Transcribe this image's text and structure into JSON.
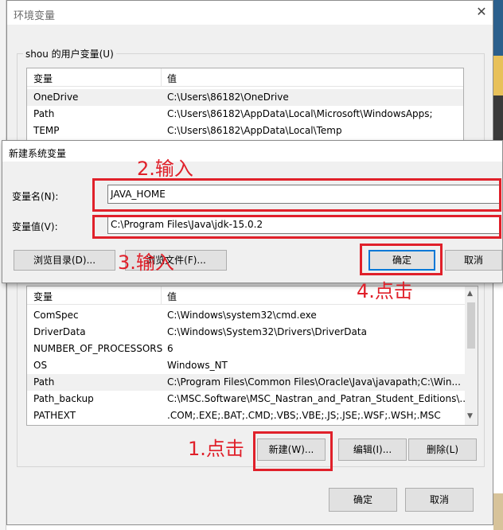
{
  "window": {
    "title": "环境变量",
    "close": "✕"
  },
  "user_vars": {
    "label": "shou 的用户变量(U)",
    "col_name": "变量",
    "col_value": "值",
    "rows": [
      {
        "name": "OneDrive",
        "value": "C:\\Users\\86182\\OneDrive"
      },
      {
        "name": "Path",
        "value": "C:\\Users\\86182\\AppData\\Local\\Microsoft\\WindowsApps;"
      },
      {
        "name": "TEMP",
        "value": "C:\\Users\\86182\\AppData\\Local\\Temp"
      }
    ]
  },
  "dialog": {
    "title": "新建系统变量",
    "name_label": "变量名(N):",
    "name_value": "JAVA_HOME",
    "value_label": "变量值(V):",
    "value_value": "C:\\Program Files\\Java\\jdk-15.0.2",
    "browse_dir": "浏览目录(D)...",
    "browse_file": "浏览文件(F)...",
    "ok": "确定",
    "cancel": "取消"
  },
  "sys_vars": {
    "col_name": "变量",
    "col_value": "值",
    "rows": [
      {
        "name": "ComSpec",
        "value": "C:\\Windows\\system32\\cmd.exe"
      },
      {
        "name": "DriverData",
        "value": "C:\\Windows\\System32\\Drivers\\DriverData"
      },
      {
        "name": "NUMBER_OF_PROCESSORS",
        "value": "6"
      },
      {
        "name": "OS",
        "value": "Windows_NT"
      },
      {
        "name": "Path",
        "value": "C:\\Program Files\\Common Files\\Oracle\\Java\\javapath;C:\\Win..."
      },
      {
        "name": "Path_backup",
        "value": "C:\\MSC.Software\\MSC_Nastran_and_Patran_Student_Editions\\..."
      },
      {
        "name": "PATHEXT",
        "value": ".COM;.EXE;.BAT;.CMD;.VBS;.VBE;.JS;.JSE;.WSF;.WSH;.MSC"
      }
    ],
    "new_btn": "新建(W)...",
    "edit_btn": "编辑(I)...",
    "delete_btn": "删除(L)"
  },
  "footer": {
    "ok": "确定",
    "cancel": "取消"
  },
  "annotations": {
    "step1": "1.点击",
    "step2": "2.输入",
    "step3": "3.输入",
    "step4": "4.点击",
    "color": "#e0202a"
  }
}
